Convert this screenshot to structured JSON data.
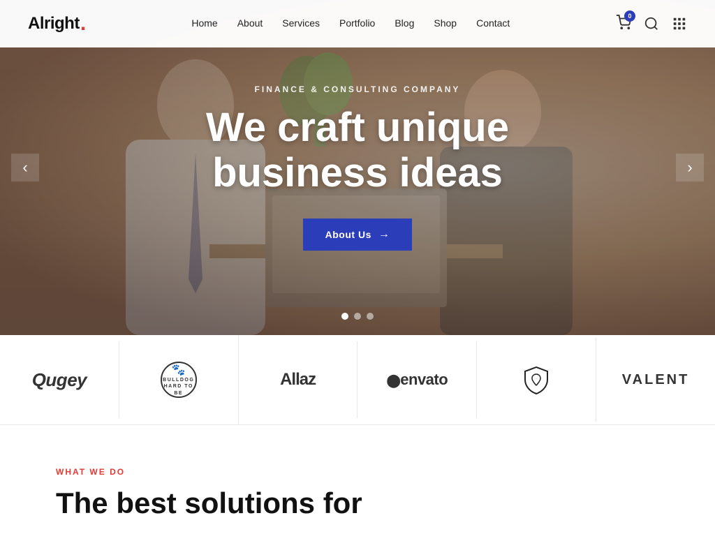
{
  "site": {
    "logo": "Alright",
    "logo_dot": ".",
    "cart_count": "0"
  },
  "nav": {
    "items": [
      {
        "label": "Home",
        "href": "#"
      },
      {
        "label": "About",
        "href": "#"
      },
      {
        "label": "Services",
        "href": "#"
      },
      {
        "label": "Portfolio",
        "href": "#"
      },
      {
        "label": "Blog",
        "href": "#"
      },
      {
        "label": "Shop",
        "href": "#"
      },
      {
        "label": "Contact",
        "href": "#"
      }
    ]
  },
  "hero": {
    "subtitle": "Finance & Consulting Company",
    "title_line1": "We craft unique",
    "title_line2": "business ideas",
    "cta_label": "About Us",
    "arrow": "→",
    "slides_total": 3,
    "active_dot": 0
  },
  "brands": [
    {
      "name": "Qugey",
      "style": "qugey",
      "type": "text"
    },
    {
      "name": "Bulldog",
      "style": "bulldog",
      "type": "badge"
    },
    {
      "name": "Allaz",
      "style": "allaz",
      "type": "text",
      "prefix": ""
    },
    {
      "name": "envato",
      "style": "envato",
      "type": "text",
      "prefix": "●"
    },
    {
      "name": "Shield",
      "style": "shield",
      "type": "icon"
    },
    {
      "name": "VALENT",
      "style": "valent",
      "type": "text"
    }
  ],
  "what_we_do": {
    "tag": "What We Do",
    "title_line1": "The best solutions for"
  },
  "arrows": {
    "left": "‹",
    "right": "›"
  }
}
